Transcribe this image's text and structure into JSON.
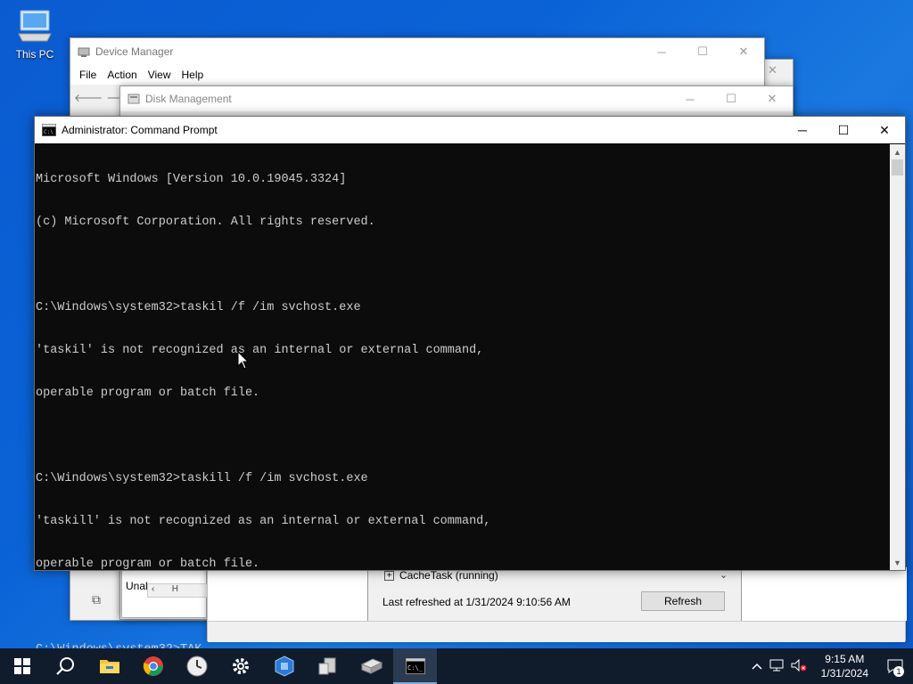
{
  "desktop": {
    "this_pc_label": "This PC"
  },
  "device_manager": {
    "title": "Device Manager",
    "menu": [
      "File",
      "Action",
      "View",
      "Help"
    ]
  },
  "disk_management": {
    "title": "Disk Management"
  },
  "services_panel": {
    "row_label": "CacheTask (running)",
    "last_refreshed": "Last refreshed at 1/31/2024 9:10:56 AM",
    "refresh_label": "Refresh",
    "left_text": "Unal",
    "left_scroll_text": "H"
  },
  "cmd": {
    "title": "Administrator: Command Prompt",
    "lines": [
      "Microsoft Windows [Version 10.0.19045.3324]",
      "(c) Microsoft Corporation. All rights reserved.",
      "",
      "C:\\Windows\\system32>taskil /f /im svchost.exe",
      "'taskil' is not recognized as an internal or external command,",
      "operable program or batch file.",
      "",
      "C:\\Windows\\system32>taskill /f /im svchost.exe",
      "'taskill' is not recognized as an internal or external command,",
      "operable program or batch file.",
      ""
    ],
    "prompt": "C:\\Windows\\system32>",
    "input": "TAK"
  },
  "taskbar": {
    "apps": [
      "start-icon",
      "search-icon",
      "file-explorer-icon",
      "chrome-icon",
      "clock-app-icon",
      "settings-icon",
      "network-config-icon",
      "server-manager-icon",
      "disk-management-icon",
      "command-prompt-icon"
    ],
    "time": "9:15 AM",
    "date": "1/31/2024",
    "notification_count": "1"
  },
  "colors": {
    "console_bg": "#0c0c0c",
    "console_fg": "#cccccc",
    "taskbar_bg": "#101c2c",
    "desktop_blue": "#0a63d6"
  }
}
